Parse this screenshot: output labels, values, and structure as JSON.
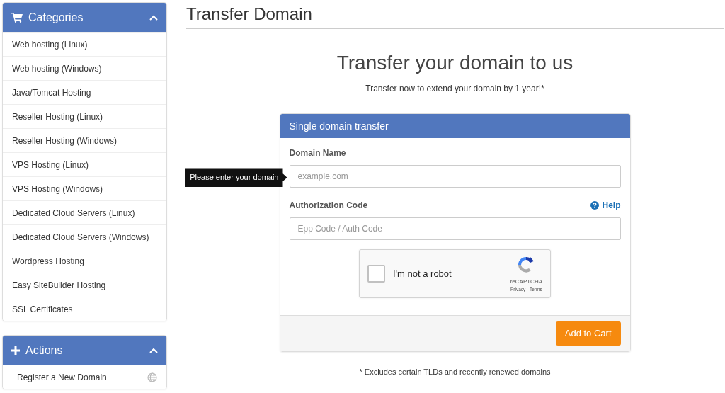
{
  "sidebar": {
    "panels": [
      {
        "kind": "cart",
        "title": "Categories",
        "expanded": true,
        "items": [
          {
            "label": "Web hosting (Linux)"
          },
          {
            "label": "Web hosting (Windows)"
          },
          {
            "label": "Java/Tomcat Hosting"
          },
          {
            "label": "Reseller Hosting (Linux)"
          },
          {
            "label": "Reseller Hosting (Windows)"
          },
          {
            "label": "VPS Hosting (Linux)"
          },
          {
            "label": "VPS Hosting (Windows)"
          },
          {
            "label": "Dedicated Cloud Servers (Linux)"
          },
          {
            "label": "Dedicated Cloud Servers (Windows)"
          },
          {
            "label": "Wordpress Hosting"
          },
          {
            "label": "Easy SiteBuilder Hosting"
          },
          {
            "label": "SSL Certificates"
          }
        ]
      },
      {
        "kind": "plus",
        "title": "Actions",
        "expanded": true,
        "items": [
          {
            "label": "Register a New Domain",
            "kind": "globe"
          }
        ]
      }
    ]
  },
  "page_title": "Transfer Domain",
  "hero": {
    "title": "Transfer your domain to us",
    "subtitle": "Transfer now to extend your domain by 1 year!*"
  },
  "card": {
    "title": "Single domain transfer",
    "fields": [
      {
        "label": "Domain Name",
        "placeholder": "example.com",
        "tooltip": "Please enter your domain"
      },
      {
        "label": "Authorization Code",
        "placeholder": "Epp Code / Auth Code",
        "help": "Help"
      }
    ],
    "captcha": {
      "label": "I'm not a robot",
      "checked": false,
      "brand": "reCAPTCHA",
      "links": "Privacy - Terms"
    },
    "button": "Add to Cart"
  },
  "footnote": "* Excludes certain TLDs and recently renewed domains"
}
